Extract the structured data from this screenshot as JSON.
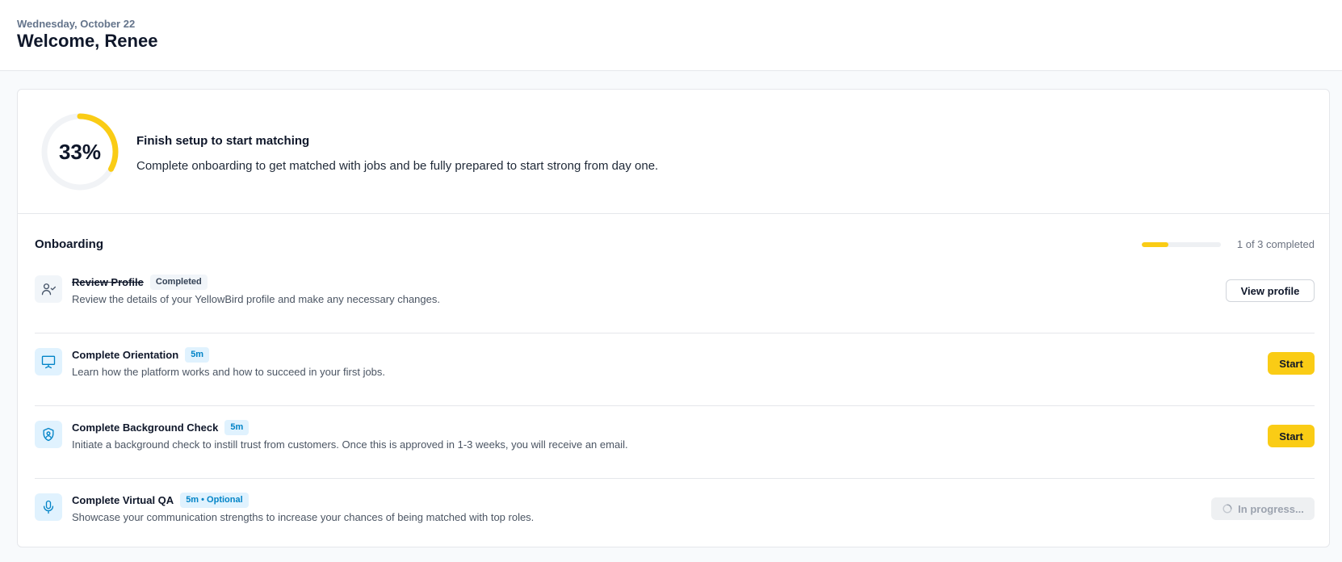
{
  "header": {
    "date": "Wednesday, October 22",
    "welcome": "Welcome, Renee"
  },
  "setup": {
    "percent_label": "33%",
    "progress_fraction": 0.33,
    "title": "Finish setup to start matching",
    "description": "Complete onboarding to get matched with jobs and be fully prepared to start strong from day one."
  },
  "onboarding": {
    "title": "Onboarding",
    "completed_fraction": 0.333,
    "progress_text": "1 of 3 completed",
    "tasks": [
      {
        "icon": "user-check-icon",
        "title": "Review Profile",
        "tag": "Completed",
        "description": "Review the details of your YellowBird profile and make any necessary changes.",
        "button": "View profile",
        "status": "completed"
      },
      {
        "icon": "presentation-icon",
        "title": "Complete Orientation",
        "tag": "5m",
        "description": "Learn how the platform works and how to succeed in your first jobs.",
        "button": "Start",
        "status": "todo"
      },
      {
        "icon": "shield-user-icon",
        "title": "Complete Background Check",
        "tag": "5m",
        "description": "Initiate a background check to instill trust from customers. Once this is approved in 1-3 weeks, you will receive an email.",
        "button": "Start",
        "status": "todo"
      },
      {
        "icon": "microphone-icon",
        "title": "Complete Virtual QA",
        "tag": "5m • Optional",
        "description": "Showcase your communication strengths to increase your chances of being matched with top roles.",
        "button": "In progress...",
        "status": "in-progress"
      }
    ]
  },
  "colors": {
    "accent": "#facc15",
    "info_tag_bg": "#e0f2fe",
    "info_tag_text": "#0284c7"
  }
}
